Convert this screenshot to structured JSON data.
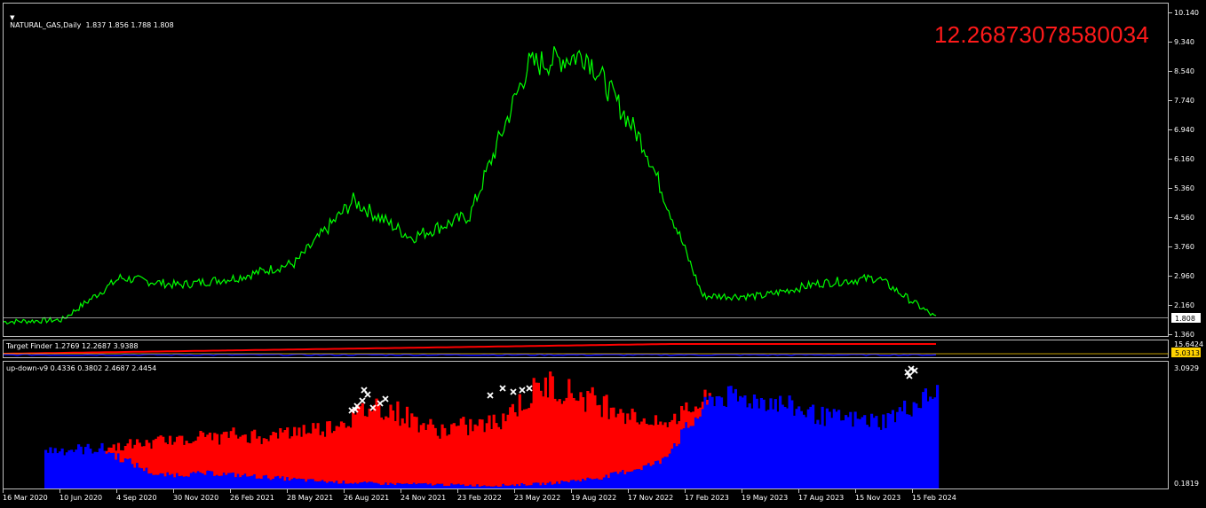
{
  "symbol_header": {
    "dropdown_glyph": "▼",
    "text": "NATURAL_GAS,Daily  1.837 1.856 1.788 1.808"
  },
  "big_value": "12.26873078580034",
  "colors": {
    "price_line": "#00ff00",
    "up_fill": "#0000ff",
    "down_fill": "#ff0000",
    "marker": "#ffffff",
    "target_line": "#ff0000",
    "big_value": "#ff1a1a",
    "current_price_line": "#c0c0c0",
    "tf_tag_bg": "#ffd200"
  },
  "price_axis": {
    "ticks": [
      "10.140",
      "9.340",
      "8.540",
      "7.740",
      "6.940",
      "6.160",
      "5.360",
      "4.560",
      "3.760",
      "2.960",
      "2.160",
      "1.360"
    ],
    "current_price": "1.808"
  },
  "target_finder": {
    "label": "Target Finder 1.2769 12.2687 3.9388",
    "axis_top": "15.6424",
    "axis_tag": "5.0313"
  },
  "up_down": {
    "label": "up-down-v9 0.4336 0.3802 2.4687 2.4454",
    "axis_top": "3.0929",
    "axis_bottom": "0.1819"
  },
  "time_axis": [
    "16 Mar 2020",
    "10 Jun 2020",
    "4 Sep 2020",
    "30 Nov 2020",
    "26 Feb 2021",
    "28 May 2021",
    "26 Aug 2021",
    "24 Nov 2021",
    "23 Feb 2022",
    "23 May 2022",
    "19 Aug 2022",
    "17 Nov 2022",
    "17 Feb 2023",
    "19 May 2023",
    "17 Aug 2023",
    "15 Nov 2023",
    "15 Feb 2024"
  ],
  "chart_data": [
    {
      "type": "line",
      "title": "NATURAL_GAS,Daily",
      "x": [
        "16 Mar 2020",
        "10 Jun 2020",
        "4 Sep 2020",
        "30 Nov 2020",
        "26 Feb 2021",
        "28 May 2021",
        "26 Aug 2021",
        "24 Nov 2021",
        "23 Feb 2022",
        "23 May 2022",
        "19 Aug 2022",
        "17 Nov 2022",
        "17 Feb 2023",
        "19 May 2023",
        "17 Aug 2023",
        "15 Nov 2023",
        "15 Feb 2024"
      ],
      "series": [
        {
          "name": "NATURAL_GAS",
          "values": [
            1.7,
            1.75,
            2.9,
            2.7,
            2.9,
            3.3,
            5.0,
            4.0,
            4.6,
            8.7,
            9.0,
            6.5,
            2.4,
            2.4,
            2.75,
            2.9,
            1.81
          ]
        }
      ],
      "ylim": [
        1.36,
        10.14
      ]
    },
    {
      "type": "area",
      "title": "up-down-v9",
      "x": [
        "16 Mar 2020",
        "10 Jun 2020",
        "4 Sep 2020",
        "30 Nov 2020",
        "26 Feb 2021",
        "28 May 2021",
        "26 Aug 2021",
        "24 Nov 2021",
        "23 Feb 2022",
        "23 May 2022",
        "19 Aug 2022",
        "17 Nov 2022",
        "17 Feb 2023",
        "19 May 2023",
        "17 Aug 2023",
        "15 Nov 2023",
        "15 Feb 2024"
      ],
      "series": [
        {
          "name": "up",
          "values": [
            1.1,
            1.15,
            0.5,
            0.55,
            0.45,
            0.35,
            0.3,
            0.28,
            0.25,
            0.3,
            0.45,
            0.8,
            2.4,
            2.3,
            1.9,
            1.8,
            2.5
          ]
        },
        {
          "name": "down",
          "values": [
            0,
            0,
            0.8,
            0.9,
            1.0,
            1.3,
            1.9,
            1.3,
            1.5,
            2.4,
            1.8,
            0.9,
            0,
            0,
            0,
            0,
            0
          ]
        }
      ],
      "ylim": [
        0.1819,
        3.0929
      ]
    }
  ]
}
